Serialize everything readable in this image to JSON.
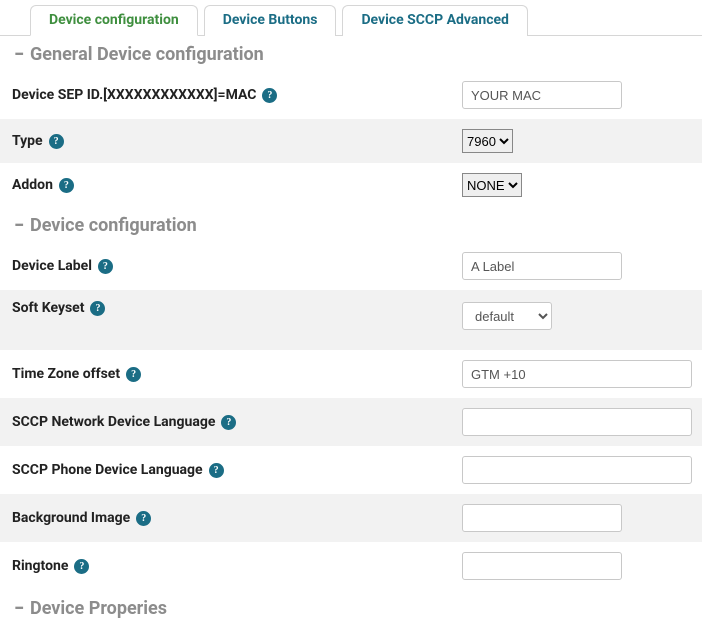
{
  "tabs": {
    "device_config": "Device configuration",
    "device_buttons": "Device Buttons",
    "device_sccp_adv": "Device SCCP Advanced"
  },
  "sections": {
    "general": "General Device configuration",
    "config": "Device configuration",
    "properties": "Device Properies"
  },
  "help_glyph": "?",
  "toggle_glyph": "−",
  "general": {
    "sep_id_label": "Device SEP ID.[XXXXXXXXXXXX]=MAC",
    "sep_id_value": "YOUR MAC",
    "type_label": "Type",
    "type_value": "7960",
    "type_options": [
      "7960"
    ],
    "addon_label": "Addon",
    "addon_value": "NONE",
    "addon_options": [
      "NONE"
    ]
  },
  "config": {
    "device_label_label": "Device Label",
    "device_label_value": "A Label",
    "soft_keyset_label": "Soft Keyset",
    "soft_keyset_value": "default",
    "soft_keyset_options": [
      "default"
    ],
    "tz_label": "Time Zone offset",
    "tz_value": "GTM +10",
    "net_lang_label": "SCCP Network Device Language",
    "net_lang_value": "",
    "phone_lang_label": "SCCP Phone Device Language",
    "phone_lang_value": "",
    "bg_label": "Background Image",
    "bg_value": "",
    "ring_label": "Ringtone",
    "ring_value": ""
  }
}
